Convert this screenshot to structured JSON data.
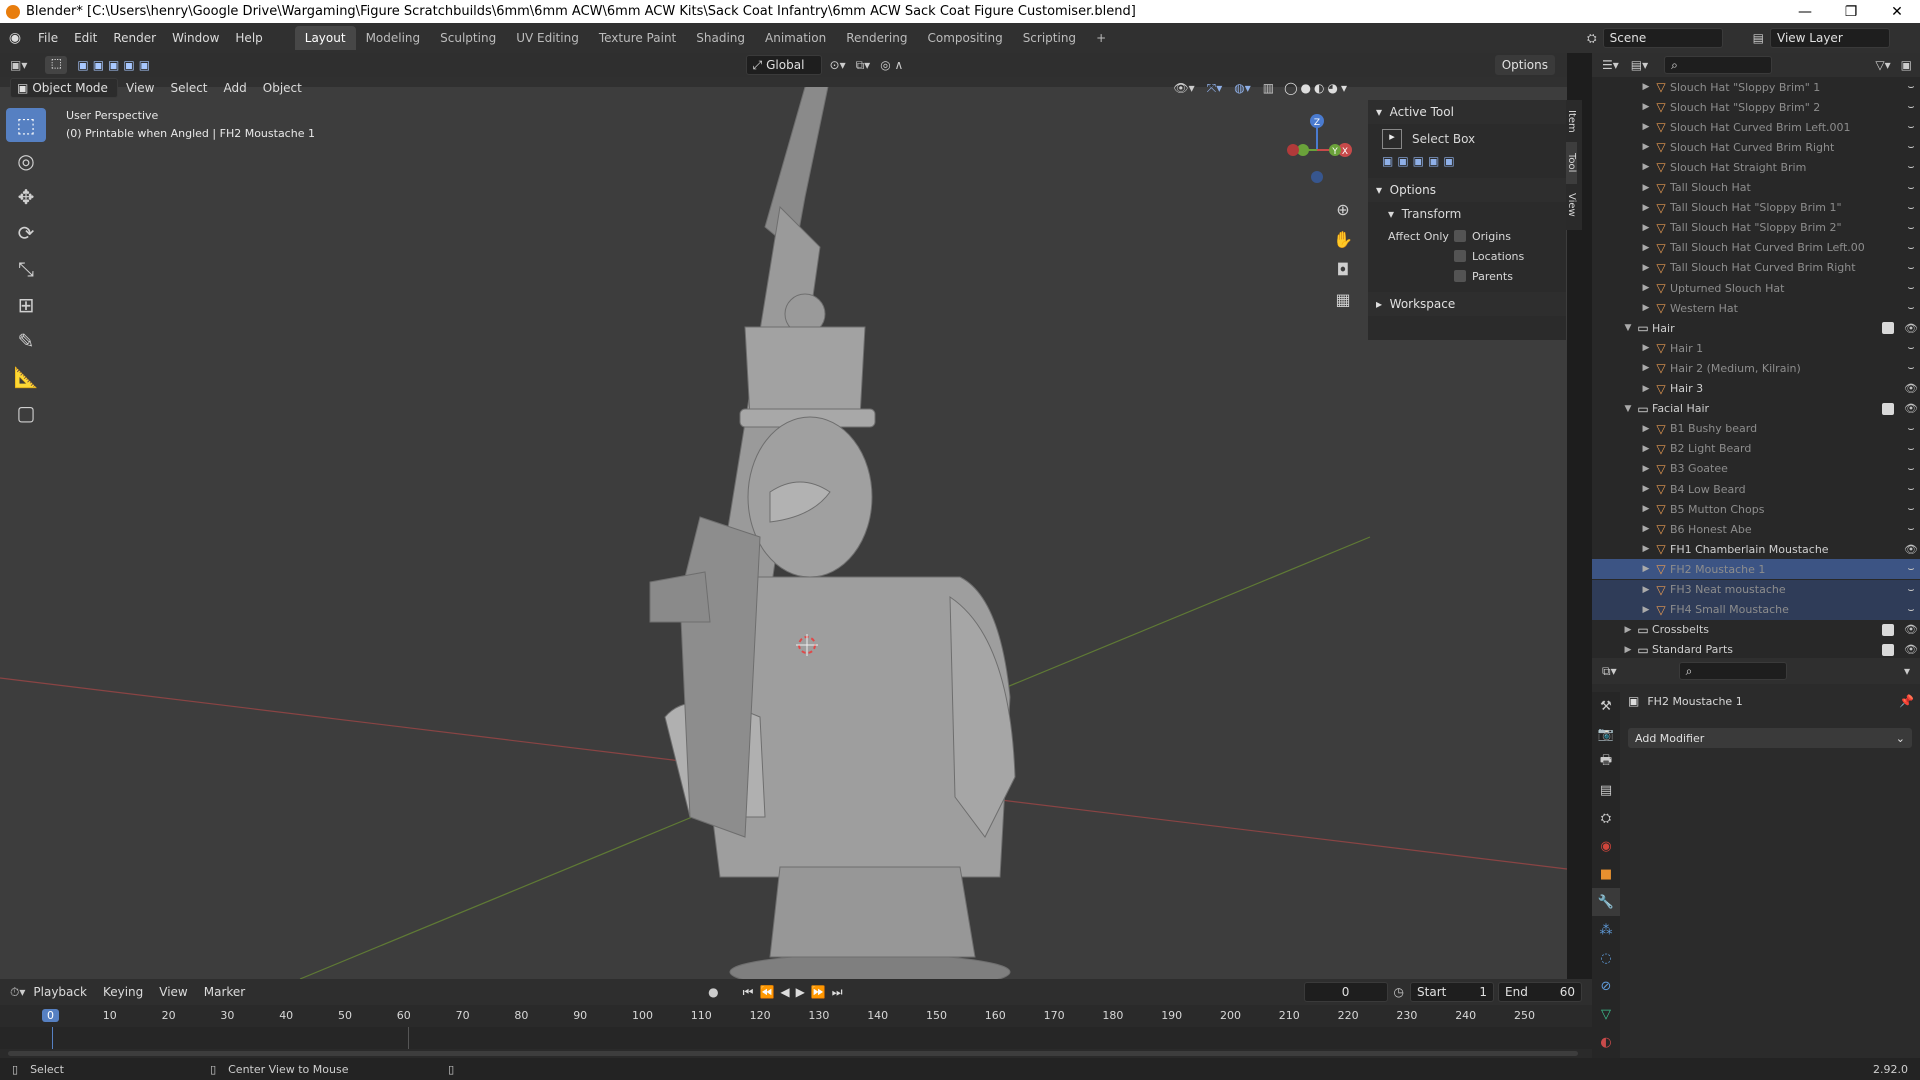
{
  "window": {
    "title": "Blender* [C:\\Users\\henry\\Google Drive\\Wargaming\\Figure Scratchbuilds\\6mm\\6mm ACW\\6mm ACW Kits\\Sack Coat Infantry\\6mm ACW Sack Coat Figure Customiser.blend]",
    "minimize": "—",
    "maximize": "❐",
    "close": "✕"
  },
  "menu": [
    "File",
    "Edit",
    "Render",
    "Window",
    "Help"
  ],
  "workspaces": [
    "Layout",
    "Modeling",
    "Sculpting",
    "UV Editing",
    "Texture Paint",
    "Shading",
    "Animation",
    "Rendering",
    "Compositing",
    "Scripting",
    "+"
  ],
  "scene": {
    "label": "Scene",
    "view_layer": "View Layer"
  },
  "viewport_header": {
    "mode": "Object Mode",
    "menus": [
      "View",
      "Select",
      "Add",
      "Object"
    ],
    "transform": "Global",
    "options": "Options"
  },
  "viewport": {
    "perspective": "User Perspective",
    "info": "(0) Printable when Angled | FH2 Moustache 1",
    "gizmo": {
      "z": "Z",
      "x": "X",
      "y": "Y"
    }
  },
  "npanel": {
    "active_tool": "Active Tool",
    "select_box": "Select Box",
    "options": "Options",
    "transform": "Transform",
    "affect_only": "Affect Only",
    "origins": "Origins",
    "locations": "Locations",
    "parents": "Parents",
    "workspace": "Workspace",
    "tabs": [
      "Item",
      "Tool",
      "View"
    ]
  },
  "outliner": {
    "rows": [
      {
        "label": "Slouch Hat \"Sloppy Brim\" 1",
        "indent": 2,
        "dim": true
      },
      {
        "label": "Slouch Hat \"Sloppy Brim\" 2",
        "indent": 2,
        "dim": true
      },
      {
        "label": "Slouch Hat Curved Brim Left.001",
        "indent": 2,
        "dim": true
      },
      {
        "label": "Slouch Hat Curved Brim Right",
        "indent": 2,
        "dim": true
      },
      {
        "label": "Slouch Hat Straight Brim",
        "indent": 2,
        "dim": true
      },
      {
        "label": "Tall Slouch Hat",
        "indent": 2,
        "dim": true
      },
      {
        "label": "Tall Slouch Hat \"Sloppy Brim 1\"",
        "indent": 2,
        "dim": true
      },
      {
        "label": "Tall Slouch Hat \"Sloppy Brim 2\"",
        "indent": 2,
        "dim": true
      },
      {
        "label": "Tall Slouch Hat Curved Brim Left.00",
        "indent": 2,
        "dim": true
      },
      {
        "label": "Tall Slouch Hat Curved Brim Right",
        "indent": 2,
        "dim": true
      },
      {
        "label": "Upturned Slouch Hat",
        "indent": 2,
        "dim": true
      },
      {
        "label": "Western Hat",
        "indent": 2,
        "dim": true
      },
      {
        "label": "Hair",
        "indent": 1,
        "collection": true
      },
      {
        "label": "Hair 1",
        "indent": 2,
        "dim": true
      },
      {
        "label": "Hair 2 (Medium, Kilrain)",
        "indent": 2,
        "dim": true
      },
      {
        "label": "Hair 3",
        "indent": 2,
        "dim": false,
        "visible": true
      },
      {
        "label": "Facial Hair",
        "indent": 1,
        "collection": true
      },
      {
        "label": "B1 Bushy beard",
        "indent": 2,
        "dim": true
      },
      {
        "label": "B2 Light Beard",
        "indent": 2,
        "dim": true
      },
      {
        "label": "B3 Goatee",
        "indent": 2,
        "dim": true
      },
      {
        "label": "B4 Low Beard",
        "indent": 2,
        "dim": true
      },
      {
        "label": "B5 Mutton Chops",
        "indent": 2,
        "dim": true
      },
      {
        "label": "B6 Honest Abe",
        "indent": 2,
        "dim": true
      },
      {
        "label": "FH1 Chamberlain Moustache",
        "indent": 2,
        "dim": false,
        "visible": true
      },
      {
        "label": "FH2 Moustache 1",
        "indent": 2,
        "dim": true,
        "selected": true
      },
      {
        "label": "FH3 Neat moustache",
        "indent": 2,
        "dim": true,
        "highlight": true
      },
      {
        "label": "FH4  Small Moustache",
        "indent": 2,
        "dim": true,
        "highlight": true
      },
      {
        "label": "Crossbelts",
        "indent": 1,
        "collection": true,
        "closed": true
      },
      {
        "label": "Standard Parts",
        "indent": 1,
        "collection": true,
        "closed": true
      }
    ]
  },
  "properties": {
    "object": "FH2 Moustache 1",
    "add_modifier": "Add Modifier"
  },
  "timeline": {
    "menus": [
      "Playback",
      "Keying",
      "View",
      "Marker"
    ],
    "current": "0",
    "start_label": "Start",
    "start": "1",
    "end_label": "End",
    "end": "60",
    "ticks": [
      "0",
      "10",
      "20",
      "30",
      "40",
      "50",
      "60",
      "70",
      "80",
      "90",
      "100",
      "110",
      "120",
      "130",
      "140",
      "150",
      "160",
      "170",
      "180",
      "190",
      "200",
      "210",
      "220",
      "230",
      "240",
      "250"
    ]
  },
  "status": {
    "select": "Select",
    "center": "Center View to Mouse",
    "version": "2.92.0"
  }
}
